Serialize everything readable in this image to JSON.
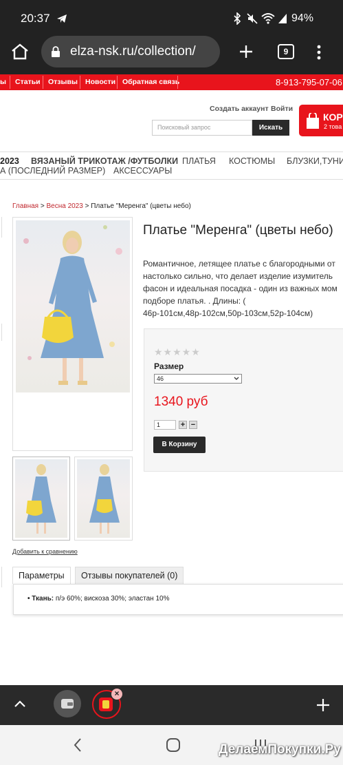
{
  "status": {
    "time": "20:37",
    "battery": "94%"
  },
  "browser": {
    "url": "elza-nsk.ru/collection/",
    "tab_count": "9"
  },
  "topnav": {
    "items": [
      "ы",
      "Статьи",
      "Отзывы",
      "Новости",
      "Обратная связь"
    ],
    "phone": "8-913-795-07-06"
  },
  "header": {
    "account_link": "Создать аккаунт",
    "login_link": "Войти",
    "search_placeholder": "Поисковый запрос",
    "search_button": "Искать",
    "cart_label": "КОРЗ",
    "cart_sub": "2 това"
  },
  "categories": {
    "row1": [
      "2023",
      "ВЯЗАНЫЙ ТРИКОТАЖ /ФУТБОЛКИ",
      "ПЛАТЬЯ",
      "КОСТЮМЫ",
      "БЛУЗКИ,ТУНИ"
    ],
    "row2": [
      "А (ПОСЛЕДНИЙ РАЗМЕР)",
      "АКСЕССУАРЫ"
    ]
  },
  "breadcrumb": {
    "home": "Главная",
    "sep1": ">",
    "section": "Весна 2023",
    "sep2": ">",
    "current": "Платье \"Меренга\" (цветы небо)"
  },
  "product": {
    "title": "Платье \"Меренга\" (цветы небо)",
    "description_lines": [
      "Романтичное, летящее платье с благородными от",
      "настолько сильно, что делает изделие изумитель",
      "фасон и идеальная посадка - один из важных мом",
      "подборе платья. . Длины: (",
      "46р-101см,48р-102см,50р-103см,52р-104см)"
    ],
    "stars": "★★★★★",
    "size_label": "Размер",
    "size_value": "46",
    "price": "1340 руб",
    "qty": "1",
    "plus": "+",
    "minus": "−",
    "add_to_cart": "В Корзину",
    "compare_link": "Добавить к сравнению"
  },
  "tabs": {
    "params": "Параметры",
    "reviews": "Отзывы покупателей (0)"
  },
  "params": {
    "fabric_label": "Ткань:",
    "fabric_value": "п/э 60%; вискоза 30%; эластан 10%"
  },
  "watermark": "ДелаемПокупки.Ру",
  "colors": {
    "brand_red": "#e8141c",
    "dark": "#2a2a2a",
    "dress_blue": "#7ea6cf",
    "bag_yellow": "#f2d53c"
  }
}
